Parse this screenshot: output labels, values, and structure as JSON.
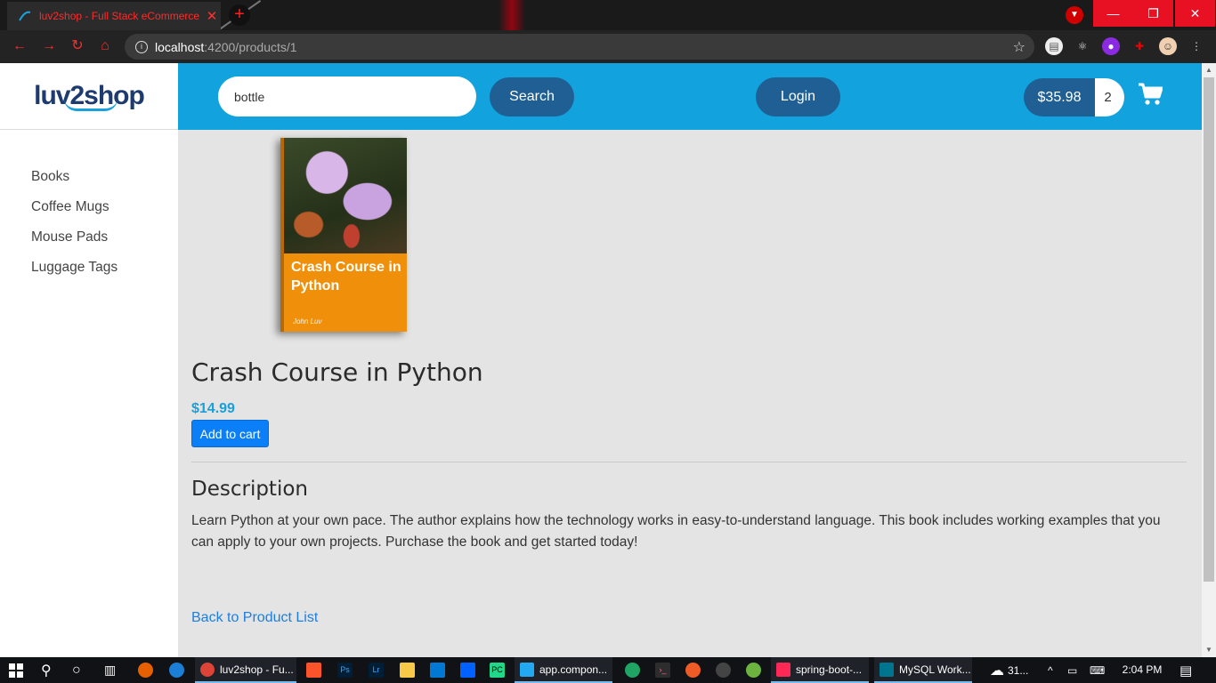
{
  "browser": {
    "tab_title": "luv2shop - Full Stack eCommerce",
    "tab_close": "✕",
    "new_tab": "+",
    "url_host": "localhost",
    "url_path": ":4200/products/1",
    "window_buttons": {
      "minimize": "—",
      "maximize": "❐",
      "close": "✕"
    }
  },
  "logo": {
    "text": "luv2shop"
  },
  "sidebar": {
    "items": [
      {
        "label": "Books"
      },
      {
        "label": "Coffee Mugs"
      },
      {
        "label": "Mouse Pads"
      },
      {
        "label": "Luggage Tags"
      }
    ]
  },
  "header": {
    "search_value": "bottle",
    "search_label": "Search",
    "login_label": "Login",
    "cart_total": "$35.98",
    "cart_quantity": "2"
  },
  "product": {
    "cover_title": "Crash Course in Python",
    "cover_author": "John Luv",
    "title": "Crash Course in Python",
    "price": "$14.99",
    "add_to_cart_label": "Add to cart",
    "description_heading": "Description",
    "description": "Learn Python at your own pace. The author explains how the technology works in easy-to-understand language. This book includes working examples that you can apply to your own projects. Purchase the book and get started today!",
    "back_link": "Back to Product List"
  },
  "colors": {
    "header_bg": "#12a3df",
    "button_dark": "#1f5f93",
    "price": "#1aa0d9",
    "add_to_cart": "#0b7ff7",
    "page_bg": "#e4e4e4"
  },
  "taskbar": {
    "active_app": "luv2shop - Fu...",
    "vscode": "app.compon...",
    "intellij": "spring-boot-...",
    "mysql": "MySQL Work...",
    "weather": "31...",
    "time": "2:04 PM"
  }
}
